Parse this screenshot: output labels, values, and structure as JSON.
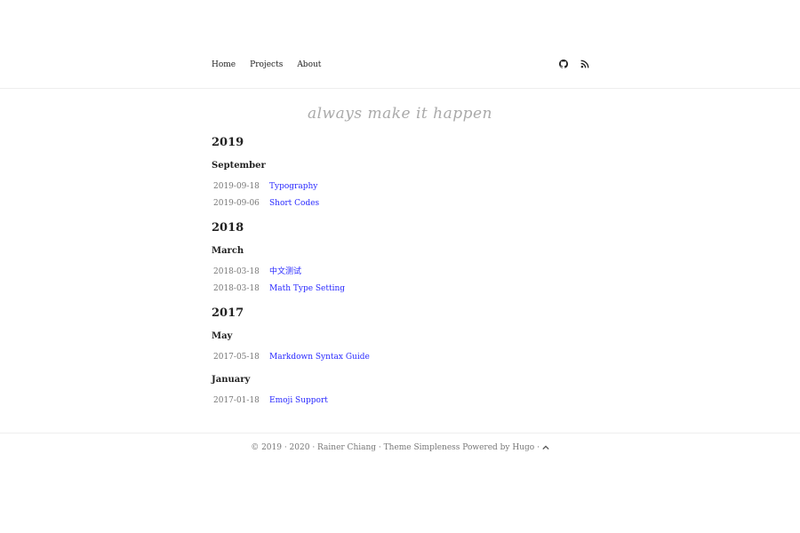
{
  "nav": {
    "links": [
      {
        "label": "Home"
      },
      {
        "label": "Projects"
      },
      {
        "label": "About"
      }
    ],
    "icons": [
      "github-icon",
      "rss-icon"
    ]
  },
  "tagline": "always make it happen",
  "archive": [
    {
      "year": "2019",
      "months": [
        {
          "month": "September",
          "posts": [
            {
              "date": "2019-09-18",
              "title": "Typography"
            },
            {
              "date": "2019-09-06",
              "title": "Short Codes"
            }
          ]
        }
      ]
    },
    {
      "year": "2018",
      "months": [
        {
          "month": "March",
          "posts": [
            {
              "date": "2018-03-18",
              "title": "中文测试"
            },
            {
              "date": "2018-03-18",
              "title": "Math Type Setting"
            }
          ]
        }
      ]
    },
    {
      "year": "2017",
      "months": [
        {
          "month": "May",
          "posts": [
            {
              "date": "2017-05-18",
              "title": "Markdown Syntax Guide"
            }
          ]
        },
        {
          "month": "January",
          "posts": [
            {
              "date": "2017-01-18",
              "title": "Emoji Support"
            }
          ]
        }
      ]
    }
  ],
  "footer": {
    "copyright": "© 2019 · 2020 · ",
    "author": "Rainer Chiang",
    "sep1": " · ",
    "theme": "Theme Simpleness",
    "sep2": " ",
    "powered": "Powered by Hugo",
    "sep3": " · "
  },
  "colors": {
    "link": "#2a2aff",
    "date": "#777777",
    "heading": "#222222",
    "divider": "#eeeeee"
  }
}
